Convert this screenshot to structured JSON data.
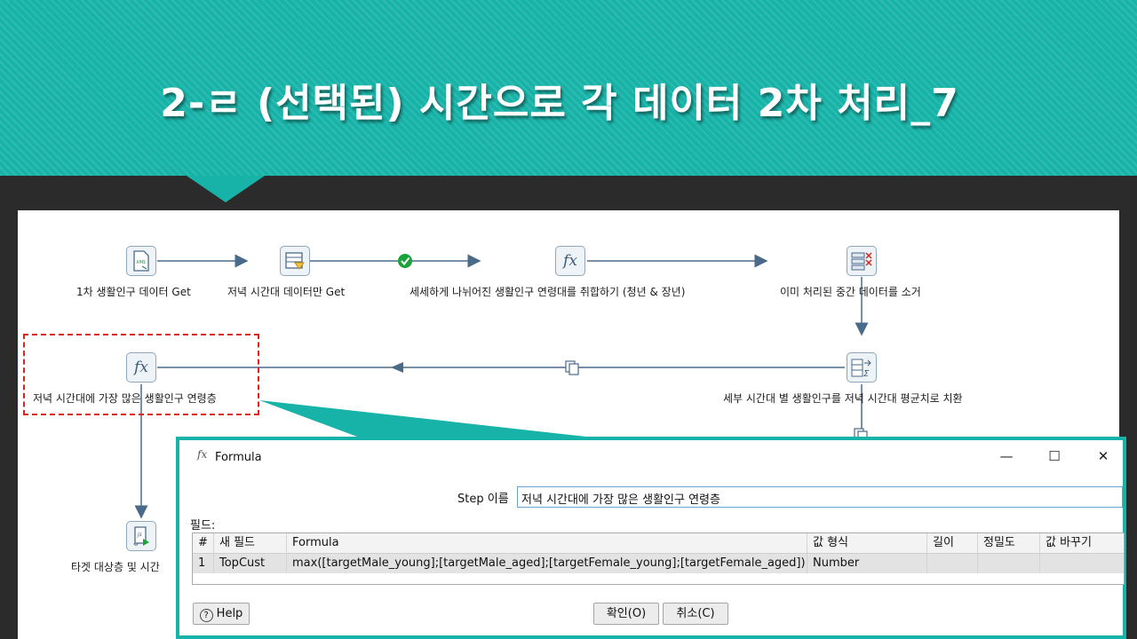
{
  "slide": {
    "title": "2-ㄹ (선택된) 시간으로 각 데이터 2차 처리_7",
    "accent_color": "#17b3a8",
    "highlight_color": "#d9251d"
  },
  "flow": {
    "nodes": [
      {
        "id": "get-data",
        "label": "1차 생활인구 데이터 Get",
        "icon": "xml-input-icon"
      },
      {
        "id": "filter",
        "label": "저녁 시간대 데이터만 Get",
        "icon": "filter-rows-icon"
      },
      {
        "id": "calc",
        "label": "세세하게 나뉘어진 생활인구 연령대를 취합하기 (청년 & 장년)",
        "icon": "formula-icon",
        "icon_text": "fx"
      },
      {
        "id": "remove",
        "label": "이미 처리된 중간 데이터를 소거",
        "icon": "select-values-icon"
      },
      {
        "id": "avg",
        "label": "세부 시간대 별 생활인구를 저녁 시간대 평균치로 치환",
        "icon": "group-by-icon"
      },
      {
        "id": "formula",
        "label": "저녁 시간대에 가장 많은 생활인구 연령층",
        "icon": "formula-icon",
        "icon_text": "fx"
      },
      {
        "id": "target",
        "label": "타겟 대상층 및 시간",
        "icon": "script-icon"
      }
    ]
  },
  "dialog": {
    "title": "Formula",
    "title_icon": "fx",
    "step_name_label": "Step 이름",
    "step_name_value": "저녁 시간대에 가장 많은 생활인구 연령층",
    "fields_label": "필드:",
    "columns": [
      "#",
      "새 필드",
      "Formula",
      "값 형식",
      "길이",
      "정밀도",
      "값 바꾸기"
    ],
    "rows": [
      [
        "1",
        "TopCust",
        "max([targetMale_young];[targetMale_aged];[targetFemale_young];[targetFemale_aged])",
        "Number",
        "",
        "",
        ""
      ]
    ],
    "help_label": "Help",
    "ok_label": "확인(O)",
    "cancel_label": "취소(C)",
    "window_buttons": {
      "minimize": "—",
      "maximize": "☐",
      "close": "✕"
    }
  }
}
